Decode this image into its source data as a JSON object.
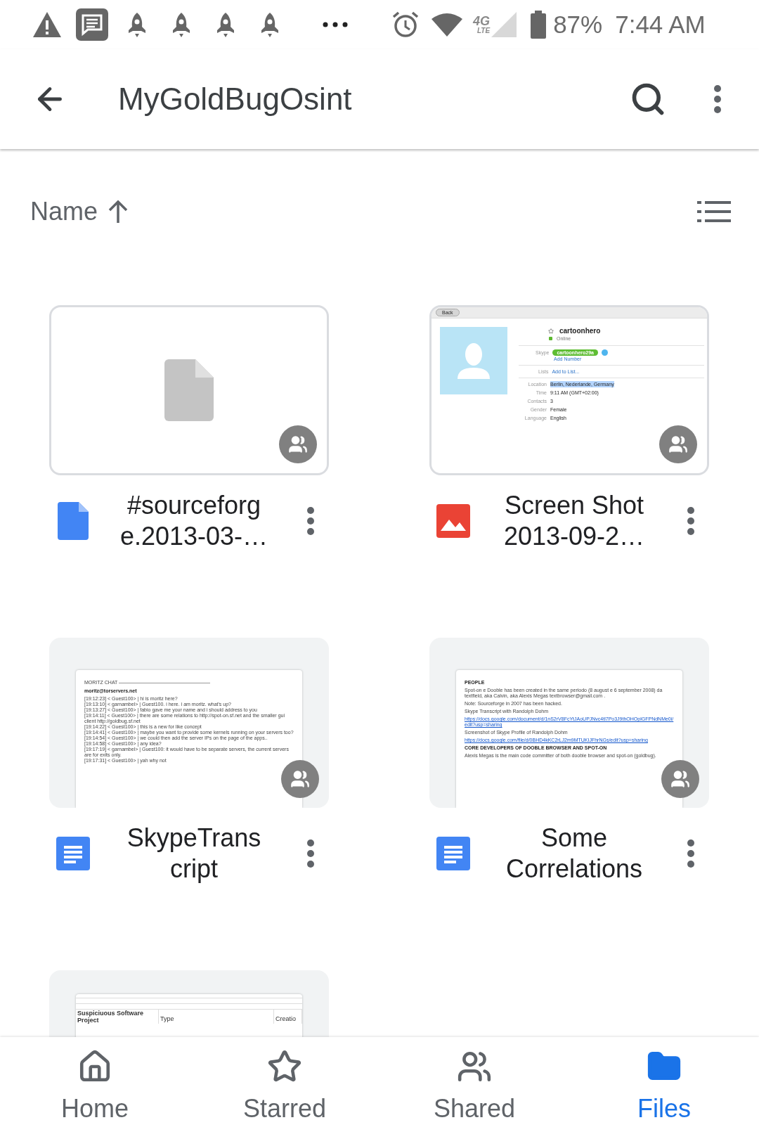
{
  "status_bar": {
    "network": "4G",
    "network_sub": "LTE",
    "battery": "87%",
    "time": "7:44 AM"
  },
  "app_bar": {
    "title": "MyGoldBugOsint"
  },
  "sort": {
    "label": "Name"
  },
  "files": [
    {
      "kind": "file",
      "title": [
        "#sourceforg",
        "e.2013-03-…"
      ],
      "shared": true,
      "preview": {
        "kind": "blank"
      }
    },
    {
      "kind": "image",
      "title": [
        "Screen Shot",
        "2013-09-2…"
      ],
      "shared": true,
      "preview": {
        "kind": "profile",
        "back": "Back",
        "name": "cartoonhero",
        "presence": "Online",
        "skype_label": "Skype",
        "skype_id": "cartoonhero29a",
        "add_number": "Add Number",
        "lists_label": "Lists",
        "add_to_list": "Add to List...",
        "details": [
          {
            "label": "Location",
            "value": "Berlin, Nederlande, Germany",
            "highlighted": true
          },
          {
            "label": "Time",
            "value": "9:11 AM (GMT+02:00)",
            "highlighted": false
          },
          {
            "label": "Contacts",
            "value": "3",
            "highlighted": false
          },
          {
            "label": "Gender",
            "value": "Female",
            "highlighted": false
          },
          {
            "label": "Language",
            "value": "English",
            "highlighted": false
          }
        ]
      }
    },
    {
      "kind": "doc",
      "title": [
        "SkypeTrans",
        "cript"
      ],
      "shared": true,
      "preview": {
        "kind": "document",
        "lines": [
          {
            "kind": "rule_heading",
            "text": "MORITZ CHAT"
          },
          {
            "kind": "bold",
            "text": "moritz@torservers.net"
          },
          {
            "kind": "text",
            "text": "[19:12:23] <  Guest100> | hi is moritz here?"
          },
          {
            "kind": "text",
            "text": "[19:13:10] <  garnambel> | Guest100. i here. i am moritz. what's up?"
          },
          {
            "kind": "text",
            "text": "[19:13:27] <  Guest100> | fabio gave me your name and i should address to you"
          },
          {
            "kind": "text",
            "text": "[19:14:11] <  Guest100> | there are some relations to http://spot-on.sf.net and the smaller gui client http://goldbug.sf.net"
          },
          {
            "kind": "text",
            "text": "[19:14:22] <  Guest100> | this is a new for like concept"
          },
          {
            "kind": "text",
            "text": "[19:14:41] <  Guest100> | maybe you want to provide some kernels running on your servers too?"
          },
          {
            "kind": "text",
            "text": "[19:14:54] <  Guest100> | we could then add the server IPs on the page of the apps.."
          },
          {
            "kind": "text",
            "text": "[19:14:58] <  Guest100> | any idea?"
          },
          {
            "kind": "text",
            "text": "[19:17:19] <  garnambel> | Guest100: it would have to be separate servers, the current servers are for exits only."
          },
          {
            "kind": "text",
            "text": "[19:17:31] <  Guest100> | yah why not"
          }
        ]
      }
    },
    {
      "kind": "doc",
      "title": [
        "Some",
        "Correlations"
      ],
      "shared": true,
      "preview": {
        "kind": "document",
        "lines": [
          {
            "kind": "bold",
            "text": "PEOPLE"
          },
          {
            "kind": "text",
            "text": "Spot-on e Dooble has been created in the same periodo (8 august e 6 september 2008) da textfield, aka Calvin, aka Alexis Megas textbrowser@gmail.com ."
          },
          {
            "kind": "text",
            "text": "Note: Sourceforge in 2007 has been hacked."
          },
          {
            "kind": "text",
            "text": "Skype Transcript with Randolph Dohm"
          },
          {
            "kind": "link",
            "text": "https://docs.google.com/document/d/1nS2rV8FcYtJAoUPJNvc4tl7Po3J9thOHOplGFPNdNMe0i/edit?usp=sharing"
          },
          {
            "kind": "text",
            "text": "Screenshot of Skype Profile of Randolph Dohm"
          },
          {
            "kind": "link",
            "text": "https://docs.google.com/file/d/0BHD4kKC2rLJ2m9MTUKIJFhrNGs/edit?usp=sharing"
          },
          {
            "kind": "bold",
            "text": "CORE DEVELOPERS OF DOOBLE BROWSER AND SPOT-ON"
          },
          {
            "kind": "text",
            "text": "Alexis Megas is the main code committer of both dooble browser and spot-on (goldbug)."
          }
        ]
      }
    },
    {
      "preview": {
        "kind": "sheet",
        "columns": [
          "Suspiciuous Software Project",
          "Type",
          "Creatio"
        ]
      }
    }
  ],
  "nav": [
    {
      "kind": "home",
      "label": "Home",
      "selected": false
    },
    {
      "kind": "starred",
      "label": "Starred",
      "selected": false
    },
    {
      "kind": "shared",
      "label": "Shared",
      "selected": false
    },
    {
      "kind": "files",
      "label": "Files",
      "selected": true
    }
  ]
}
